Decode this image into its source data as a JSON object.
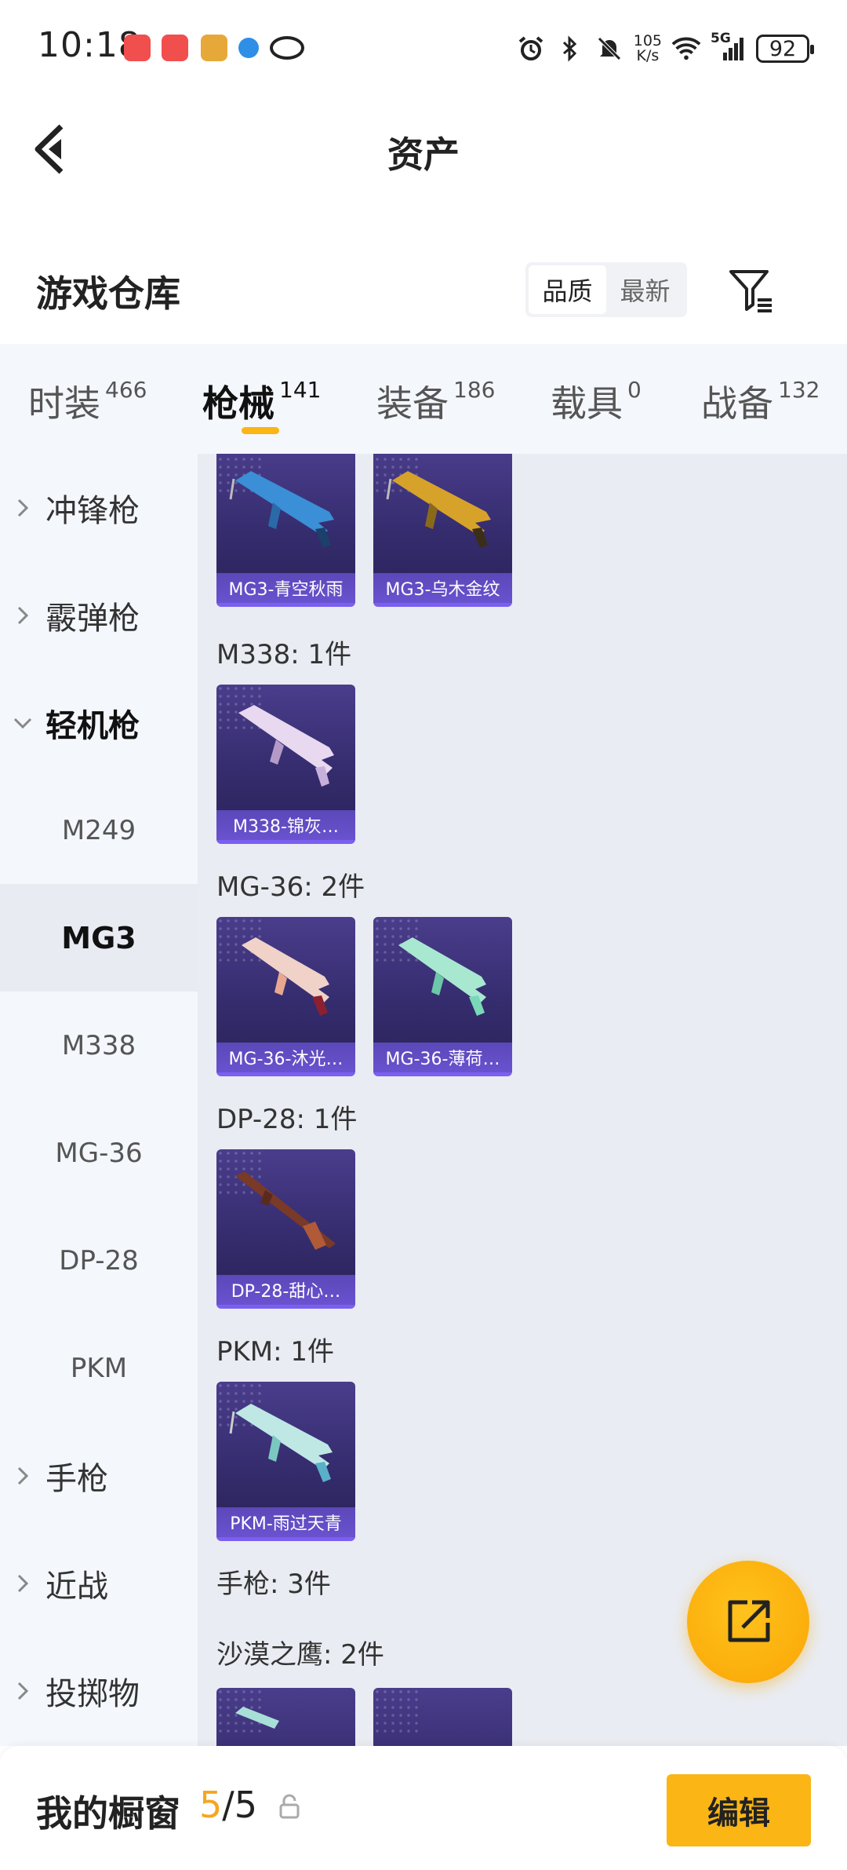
{
  "status_bar": {
    "time": "10:18",
    "net_speed_value": "105",
    "net_speed_unit": "K/s",
    "network": "5G",
    "battery": "92"
  },
  "header": {
    "title": "资产"
  },
  "section": {
    "title": "游戏仓库",
    "sort_options": [
      "品质",
      "最新"
    ],
    "active_sort": "品质"
  },
  "tabs": [
    {
      "label": "时装",
      "count": "466"
    },
    {
      "label": "枪械",
      "count": "141",
      "active": true
    },
    {
      "label": "装备",
      "count": "186"
    },
    {
      "label": "载具",
      "count": "0"
    },
    {
      "label": "战备",
      "count": "132"
    }
  ],
  "sidebar": {
    "groups": [
      {
        "label": "冲锋枪"
      },
      {
        "label": "霰弹枪"
      },
      {
        "label": "轻机枪",
        "open": true
      },
      {
        "label": "手枪"
      },
      {
        "label": "近战"
      },
      {
        "label": "投掷物"
      }
    ],
    "sub_items": [
      "M249",
      "MG3",
      "M338",
      "MG-36",
      "DP-28",
      "PKM"
    ],
    "active_sub": "MG3"
  },
  "content": {
    "groups": [
      {
        "label": "",
        "items": [
          "MG3-青空秋雨",
          "MG3-乌木金纹"
        ]
      },
      {
        "label": "M338: 1件",
        "items": [
          "M338-锦灰…"
        ]
      },
      {
        "label": "MG-36: 2件",
        "items": [
          "MG-36-沐光…",
          "MG-36-薄荷…"
        ]
      },
      {
        "label": "DP-28: 1件",
        "items": [
          "DP-28-甜心…"
        ]
      },
      {
        "label": "PKM: 1件",
        "items": [
          "PKM-雨过天青"
        ]
      }
    ],
    "pistol_group": "手枪: 3件",
    "pistol_sub": "沙漠之鹰: 2件"
  },
  "bottom_bar": {
    "title": "我的橱窗",
    "count_current": "5",
    "count_sep": "/",
    "count_total": "5",
    "edit_label": "编辑"
  },
  "colors": {
    "accent": "#fbb514",
    "card_bg": "#352c6e",
    "card_caption": "#6a52d0",
    "page_bg": "#f4f7fc",
    "content_bg": "#e9ecf2"
  }
}
